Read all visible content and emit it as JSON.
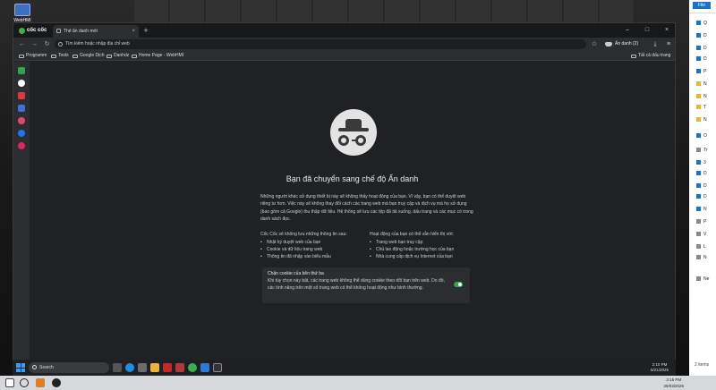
{
  "desktop": {
    "icon_label": "WebHMI"
  },
  "explorer": {
    "file_tab": "File",
    "rows": [
      "Q",
      "D",
      "D",
      "D",
      "P",
      "N",
      "N",
      "T",
      "N",
      "O",
      "Tr",
      "3",
      "D",
      "D",
      "D",
      "N",
      "P",
      "V",
      "L",
      "N",
      "Ne"
    ],
    "items_count": "2 items"
  },
  "browser": {
    "brand": "cốc cốc",
    "tab_title": "Thẻ ẩn danh mới",
    "address_placeholder": "Tìm kiếm hoặc nhập địa chỉ web",
    "incognito_chip": "Ẩn danh (2)",
    "bookmarks": [
      "Programm",
      "Tools",
      "Google Dịch",
      "Danhdz",
      "Home Page - WebHMI"
    ],
    "bookmarks_right": "Tất cả dấu trang"
  },
  "incognito_page": {
    "title": "Bạn đã chuyển sang chế độ Ẩn danh",
    "intro": "Những người khác sử dụng thiết bị này sẽ không thấy hoạt động của bạn. Vì vậy, bạn có thể duyệt web riêng tư hơn. Việc này sẽ không thay đổi cách các trang web mà bạn truy cập và dịch vụ mà họ sử dụng (bao gồm cả Google) thu thập dữ liệu. Hệ thống sẽ lưu các tệp đã tải xuống, dấu trang và các mục có trong danh sách đọc.",
    "left_heading": "Cốc Cốc sẽ không lưu những thông tin sau:",
    "left_items": [
      "Nhật ký duyệt web của bạn",
      "Cookie và dữ liệu trang web",
      "Thông tin đã nhập vào biểu mẫu"
    ],
    "right_heading": "Hoạt động của bạn có thể vẫn hiển thị với:",
    "right_items": [
      "Trang web bạn truy cập",
      "Chủ lao động hoặc trường học của bạn",
      "Nhà cung cấp dịch vụ Internet của bạn"
    ],
    "cookie_title": "Chặn cookie của bên thứ ba",
    "cookie_desc": "Khi tùy chọn này bật, các trang web không thể dùng cookie theo dõi bạn trên web. Do đó, các tính năng trên một số trang web có thể không hoạt động như bình thường.",
    "cookie_toggle_on": true
  },
  "taskbar_inner": {
    "search_label": "Search",
    "time": "2:10 PM",
    "date": "5/21/2025"
  },
  "taskbar_outer": {
    "time": "3:15 PM",
    "date": "25/03/2025"
  },
  "colors": {
    "accent_green": "#2fa84f",
    "coccoc_green": "#37b34a",
    "windows_blue": "#3c9cf0"
  }
}
